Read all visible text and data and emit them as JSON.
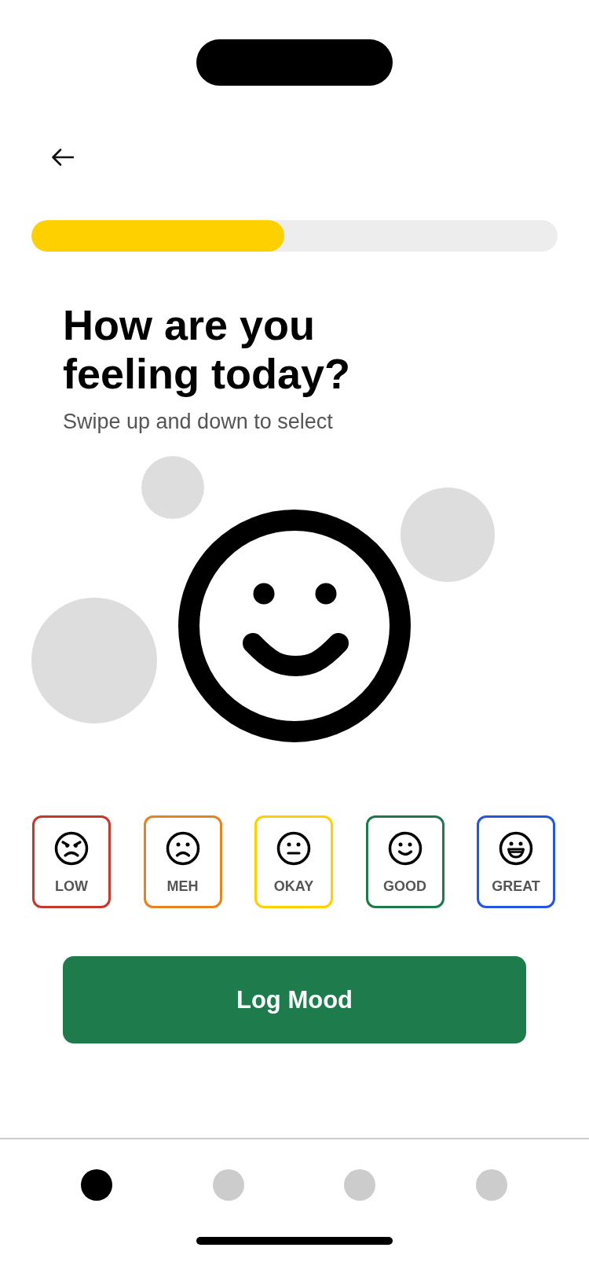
{
  "progress": {
    "level": 0.48
  },
  "heading": {
    "title": "How are you feeling today?",
    "subtitle": "Swipe up and down to select"
  },
  "moods": [
    {
      "label": "LOW",
      "kind": "angry",
      "color": "#c4392b"
    },
    {
      "label": "MEH",
      "kind": "sad",
      "color": "#e8821e"
    },
    {
      "label": "OKAY",
      "kind": "neutral",
      "color": "#ffd000"
    },
    {
      "label": "GOOD",
      "kind": "smile",
      "color": "#1e7a4a"
    },
    {
      "label": "GREAT",
      "kind": "grin",
      "color": "#2456e0"
    }
  ],
  "primary_button": {
    "label": "Log Mood"
  },
  "page_dots": [
    {
      "selected": true
    },
    {
      "selected": false
    },
    {
      "selected": false
    },
    {
      "selected": false
    }
  ]
}
